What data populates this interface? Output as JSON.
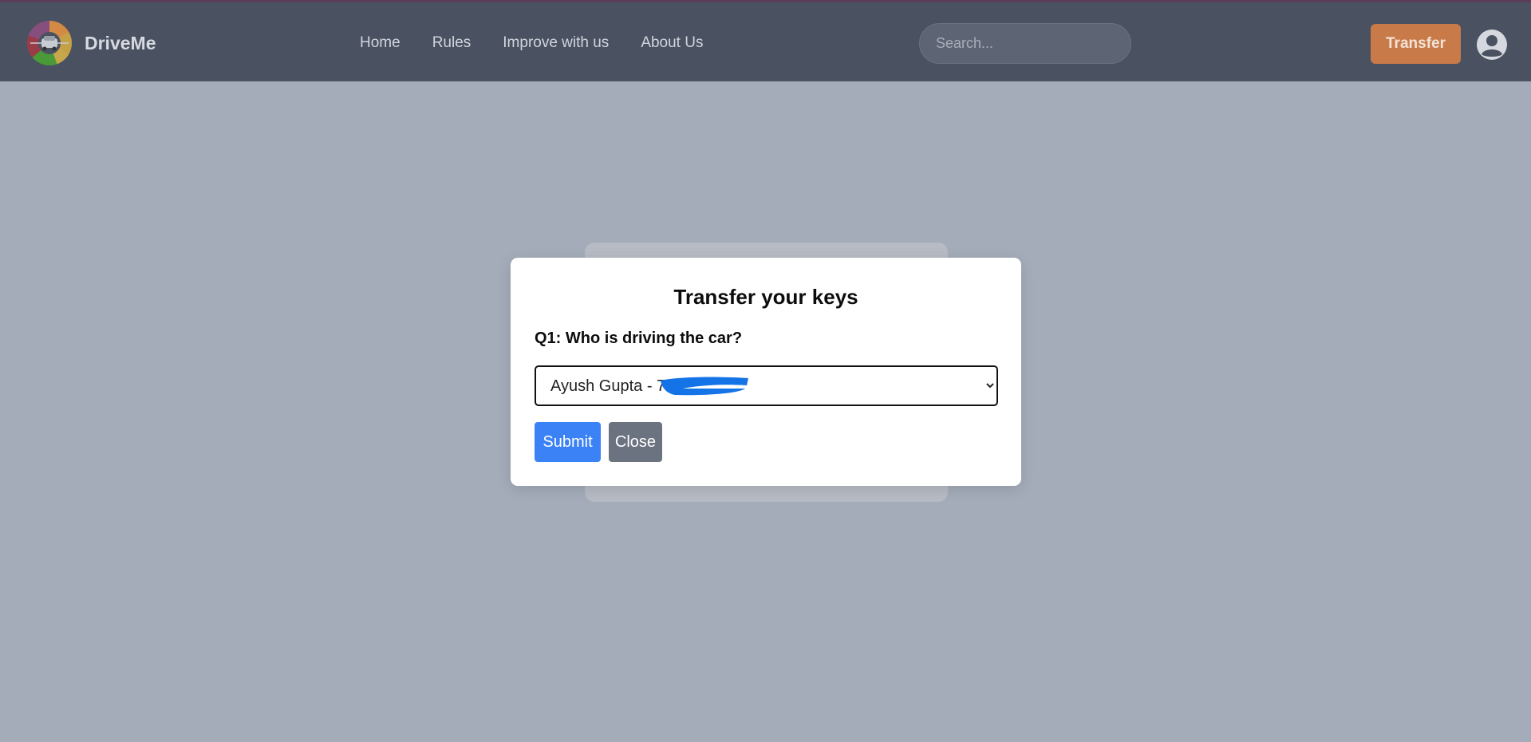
{
  "brand": {
    "name": "DriveMe",
    "logo_icon": "car-wheel-logo-icon"
  },
  "nav": {
    "links": [
      "Home",
      "Rules",
      "Improve with us",
      "About Us"
    ]
  },
  "search": {
    "placeholder": "Search..."
  },
  "header": {
    "transfer_label": "Transfer",
    "avatar_icon": "user-circle-icon"
  },
  "modal": {
    "title": "Transfer your keys",
    "question": "Q1: Who is driving the car?",
    "selected_driver": "Ayush Gupta - 70",
    "submit_label": "Submit",
    "close_label": "Close"
  },
  "colors": {
    "navbar": "#4a5160",
    "accent": "#c97a49",
    "primary": "#3b82f6",
    "secondary": "#6b7280"
  }
}
